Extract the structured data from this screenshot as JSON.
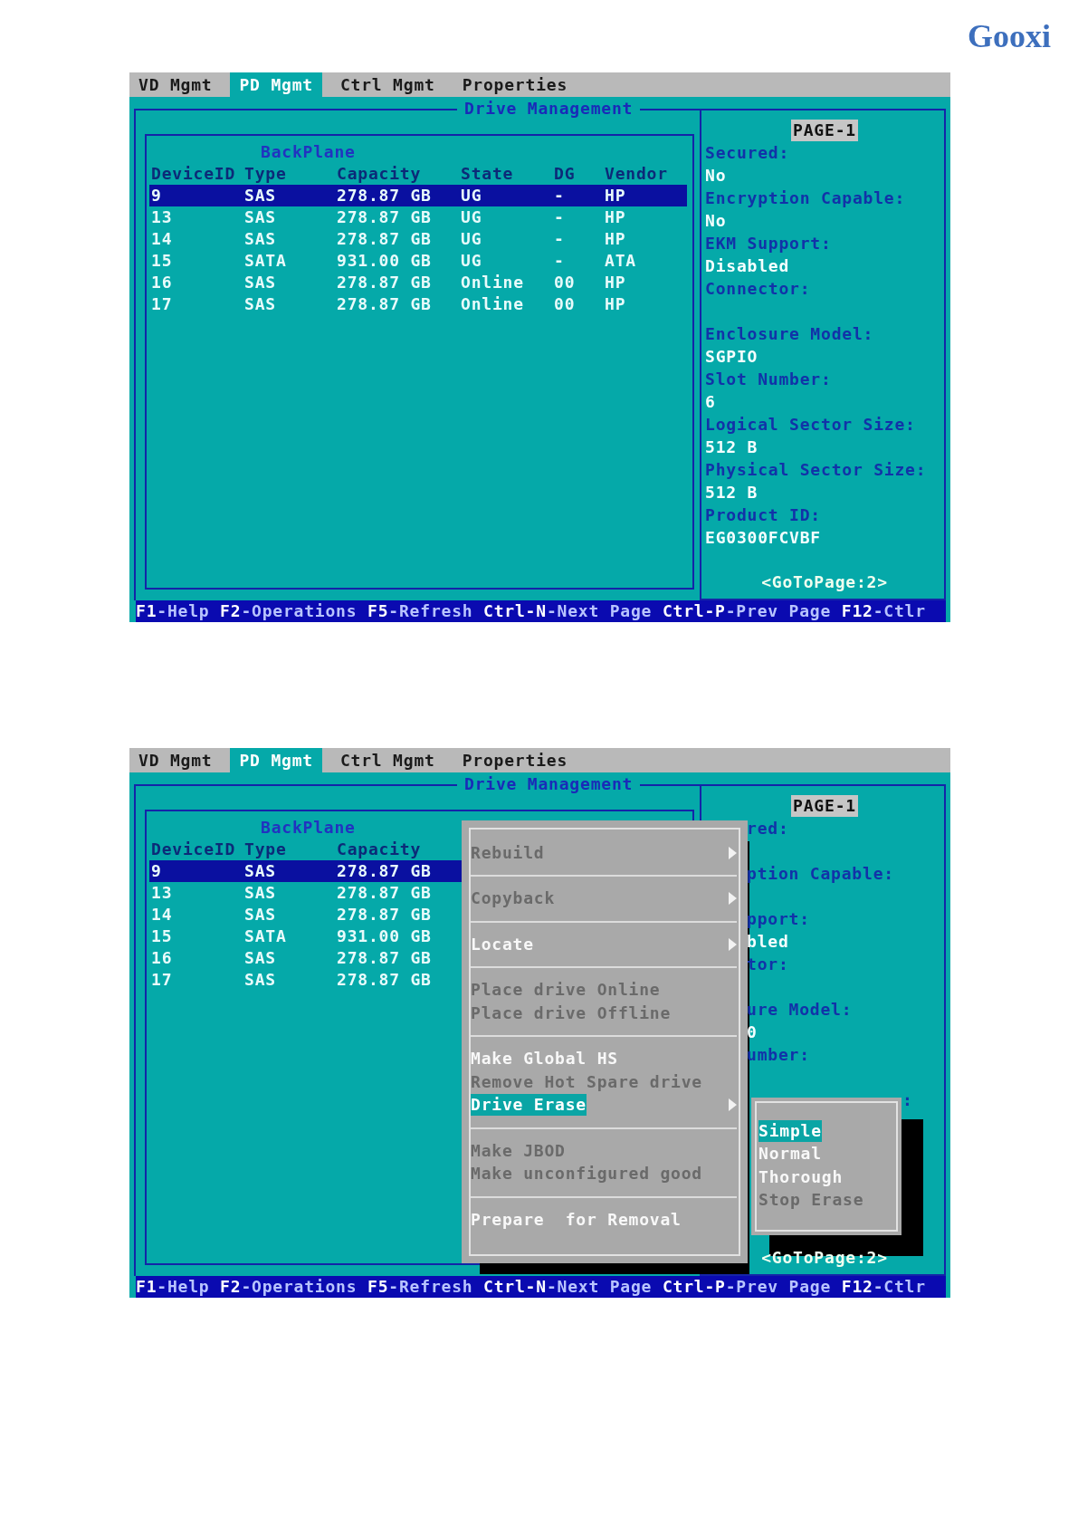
{
  "logo": "Gooxi",
  "screens": [
    {
      "tabs": [
        {
          "label": "VD Mgmt",
          "selected": false
        },
        {
          "label": "PD Mgmt",
          "selected": true
        },
        {
          "label": "Ctrl Mgmt",
          "selected": false
        },
        {
          "label": "Properties",
          "selected": false
        }
      ],
      "panel_title": "Drive Management",
      "table": {
        "section": "BackPlane",
        "columns": [
          "DeviceID",
          "Type",
          "Capacity",
          "State",
          "DG",
          "Vendor"
        ],
        "rows": [
          {
            "cells": [
              "9",
              "SAS",
              "278.87 GB",
              "UG",
              "-",
              "HP"
            ],
            "selected": true
          },
          {
            "cells": [
              "13",
              "SAS",
              "278.87 GB",
              "UG",
              "-",
              "HP"
            ],
            "selected": false
          },
          {
            "cells": [
              "14",
              "SAS",
              "278.87 GB",
              "UG",
              "-",
              "HP"
            ],
            "selected": false
          },
          {
            "cells": [
              "15",
              "SATA",
              "931.00 GB",
              "UG",
              "-",
              "ATA"
            ],
            "selected": false
          },
          {
            "cells": [
              "16",
              "SAS",
              "278.87 GB",
              "Online",
              "00",
              "HP"
            ],
            "selected": false
          },
          {
            "cells": [
              "17",
              "SAS",
              "278.87 GB",
              "Online",
              "00",
              "HP"
            ],
            "selected": false
          }
        ]
      },
      "details": {
        "page": "PAGE-1",
        "lines": [
          {
            "kind": "label",
            "text": "Secured:"
          },
          {
            "kind": "value",
            "text": "No"
          },
          {
            "kind": "label",
            "text": "Encryption Capable:"
          },
          {
            "kind": "value",
            "text": "No"
          },
          {
            "kind": "label",
            "text": "EKM Support:"
          },
          {
            "kind": "value",
            "text": "Disabled"
          },
          {
            "kind": "label",
            "text": "Connector:"
          },
          {
            "kind": "blank"
          },
          {
            "kind": "label",
            "text": "Enclosure Model:"
          },
          {
            "kind": "value",
            "text": "SGPIO"
          },
          {
            "kind": "label",
            "text": "Slot Number:"
          },
          {
            "kind": "value",
            "text": "6"
          },
          {
            "kind": "label",
            "text": "Logical Sector Size:"
          },
          {
            "kind": "value",
            "text": "512 B"
          },
          {
            "kind": "label",
            "text": "Physical Sector Size:"
          },
          {
            "kind": "value",
            "text": "512 B"
          },
          {
            "kind": "label",
            "text": "Product ID:"
          },
          {
            "kind": "value",
            "text": "EG0300FCVBF"
          }
        ],
        "link": "<GoToPage:2>"
      },
      "footer": "**F1**-Help **F2**-Operations **F5**-Refresh **Ctrl-N**-Next Page **Ctrl-P**-Prev Page **F12**-Ctlr"
    },
    {
      "tabs": [
        {
          "label": "VD Mgmt",
          "selected": false
        },
        {
          "label": "PD Mgmt",
          "selected": true
        },
        {
          "label": "Ctrl Mgmt",
          "selected": false
        },
        {
          "label": "Properties",
          "selected": false
        }
      ],
      "panel_title": "Drive Management",
      "table": {
        "section": "BackPlane",
        "columns": [
          "DeviceID",
          "Type",
          "Capacity"
        ],
        "rows": [
          {
            "cells": [
              "9",
              "SAS",
              "278.87 GB"
            ],
            "selected": true
          },
          {
            "cells": [
              "13",
              "SAS",
              "278.87 GB"
            ],
            "selected": false
          },
          {
            "cells": [
              "14",
              "SAS",
              "278.87 GB"
            ],
            "selected": false
          },
          {
            "cells": [
              "15",
              "SATA",
              "931.00 GB"
            ],
            "selected": false
          },
          {
            "cells": [
              "16",
              "SAS",
              "278.87 GB"
            ],
            "selected": false
          },
          {
            "cells": [
              "17",
              "SAS",
              "278.87 GB"
            ],
            "selected": false
          }
        ]
      },
      "details": {
        "page": "PAGE-1",
        "lines": [
          {
            "kind": "label",
            "text": "red:"
          },
          {
            "kind": "blank"
          },
          {
            "kind": "label",
            "text": "ption Capable:"
          },
          {
            "kind": "blank"
          },
          {
            "kind": "label",
            "text": "pport:"
          },
          {
            "kind": "value",
            "text": "bled"
          },
          {
            "kind": "label",
            "text": "tor:"
          },
          {
            "kind": "blank"
          },
          {
            "kind": "label",
            "text": "ure Model:"
          },
          {
            "kind": "value",
            "text": "0"
          },
          {
            "kind": "label",
            "text": "umber:"
          },
          {
            "kind": "blank"
          },
          {
            "kind": "tail",
            "text": ":"
          }
        ],
        "link": "<GoToPage:2>"
      },
      "footer": "**F1**-Help **F2**-Operations **F5**-Refresh **Ctrl-N**-Next Page **Ctrl-P**-Prev Page **F12**-Ctlr",
      "popup": {
        "groups": [
          [
            {
              "text": "Rebuild",
              "disabled": true,
              "selected": false,
              "submenu": true
            }
          ],
          [
            {
              "text": "Copyback",
              "disabled": true,
              "selected": false,
              "submenu": true
            }
          ],
          [
            {
              "text": "Locate",
              "disabled": false,
              "selected": false,
              "submenu": true
            }
          ],
          [
            {
              "text": "Place drive Online",
              "disabled": true,
              "selected": false,
              "submenu": false
            },
            {
              "text": "Place drive Offline",
              "disabled": true,
              "selected": false,
              "submenu": false
            }
          ],
          [
            {
              "text": "Make Global HS",
              "disabled": false,
              "selected": false,
              "submenu": false
            },
            {
              "text": "Remove Hot Spare drive",
              "disabled": true,
              "selected": false,
              "submenu": false
            },
            {
              "text": "Drive Erase",
              "disabled": false,
              "selected": true,
              "submenu": true
            }
          ],
          [
            {
              "text": "Make JBOD",
              "disabled": true,
              "selected": false,
              "submenu": false
            },
            {
              "text": "Make unconfigured good",
              "disabled": true,
              "selected": false,
              "submenu": false
            }
          ],
          [
            {
              "text": "Prepare  for Removal",
              "disabled": false,
              "selected": false,
              "submenu": false
            }
          ]
        ]
      },
      "submenu": {
        "items": [
          {
            "text": "Simple",
            "disabled": false,
            "selected": true
          },
          {
            "text": "Normal",
            "disabled": false,
            "selected": false
          },
          {
            "text": "Thorough",
            "disabled": false,
            "selected": false
          },
          {
            "text": "Stop Erase",
            "disabled": true,
            "selected": false
          }
        ]
      }
    }
  ]
}
